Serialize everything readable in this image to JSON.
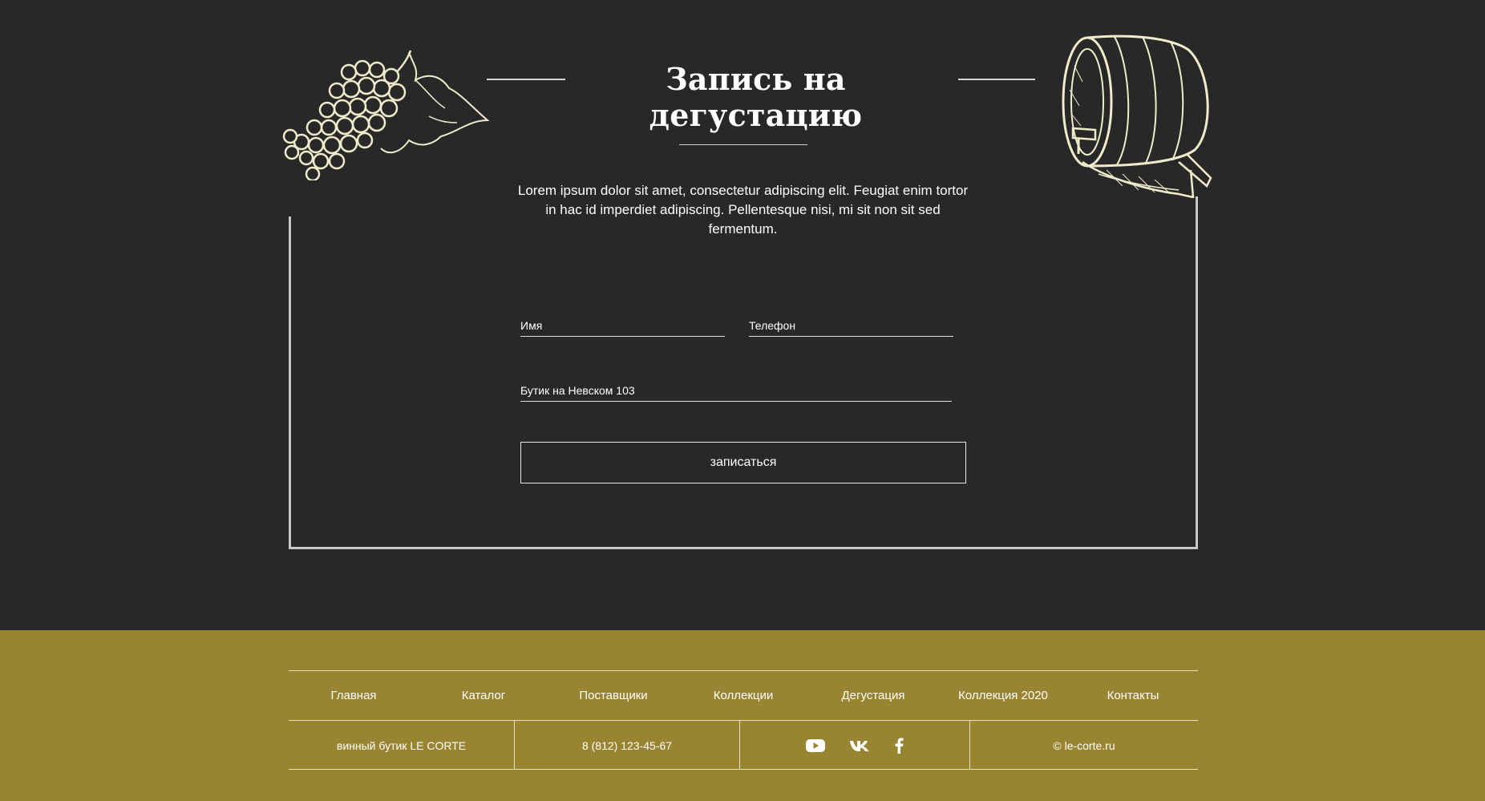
{
  "form_section": {
    "title": "Запись на дегустацию",
    "description": "Lorem ipsum dolor sit amet, consectetur adipiscing elit. Feugiat enim tortor in hac id imperdiet adipiscing. Pellentesque nisi, mi sit non sit sed fermentum.",
    "fields": {
      "name_placeholder": "Имя",
      "phone_placeholder": "Телефон",
      "boutique_value": "Бутик на Невском 103"
    },
    "submit_label": "записаться"
  },
  "footer": {
    "nav": [
      "Главная",
      "Каталог",
      "Поставщики",
      "Коллекции",
      "Дегустация",
      "Коллекция 2020",
      "Контакты"
    ],
    "brand": "винный бутик LE CORTE",
    "phone": "8 (812) 123-45-67",
    "social_icons": [
      "youtube-icon",
      "vk-icon",
      "facebook-icon"
    ],
    "copyright": "© le-corte.ru"
  },
  "colors": {
    "background": "#282828",
    "footer_background": "#998431",
    "sketch": "#efeccb"
  }
}
